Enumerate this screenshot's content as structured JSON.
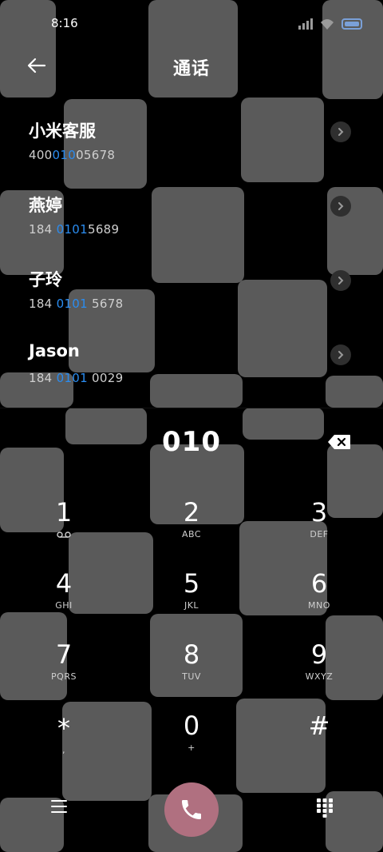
{
  "status": {
    "time": "8:16"
  },
  "header": {
    "title": "通话"
  },
  "contacts": [
    {
      "name": "小米客服",
      "number_pre": "400",
      "number_hl": "010",
      "number_post": "05678"
    },
    {
      "name": "燕婷",
      "number_pre": "184 ",
      "number_hl": "0101",
      "number_post": "5689"
    },
    {
      "name": "子玲",
      "number_pre": "184 ",
      "number_hl": "0101",
      "number_post": " 5678"
    },
    {
      "name": "Jason",
      "number_pre": "184 ",
      "number_hl": "0101",
      "number_post": " 0029"
    }
  ],
  "dialer": {
    "input": "010"
  },
  "keypad": [
    {
      "digit": "1",
      "letters": ""
    },
    {
      "digit": "2",
      "letters": "ABC"
    },
    {
      "digit": "3",
      "letters": "DEF"
    },
    {
      "digit": "4",
      "letters": "GHI"
    },
    {
      "digit": "5",
      "letters": "JKL"
    },
    {
      "digit": "6",
      "letters": "MNO"
    },
    {
      "digit": "7",
      "letters": "PQRS"
    },
    {
      "digit": "8",
      "letters": "TUV"
    },
    {
      "digit": "9",
      "letters": "WXYZ"
    },
    {
      "digit": "*",
      "letters": ","
    },
    {
      "digit": "0",
      "letters": "+"
    },
    {
      "digit": "#",
      "letters": ""
    }
  ],
  "colors": {
    "highlight": "#2a8cf0",
    "call_button": "#b07080",
    "tile": "#5a5a5a"
  },
  "icons": [
    "back-arrow-icon",
    "chevron-right-icon",
    "backspace-icon",
    "voicemail-icon",
    "menu-icon",
    "phone-icon",
    "dialpad-icon",
    "signal-icon",
    "wifi-icon",
    "battery-icon"
  ]
}
